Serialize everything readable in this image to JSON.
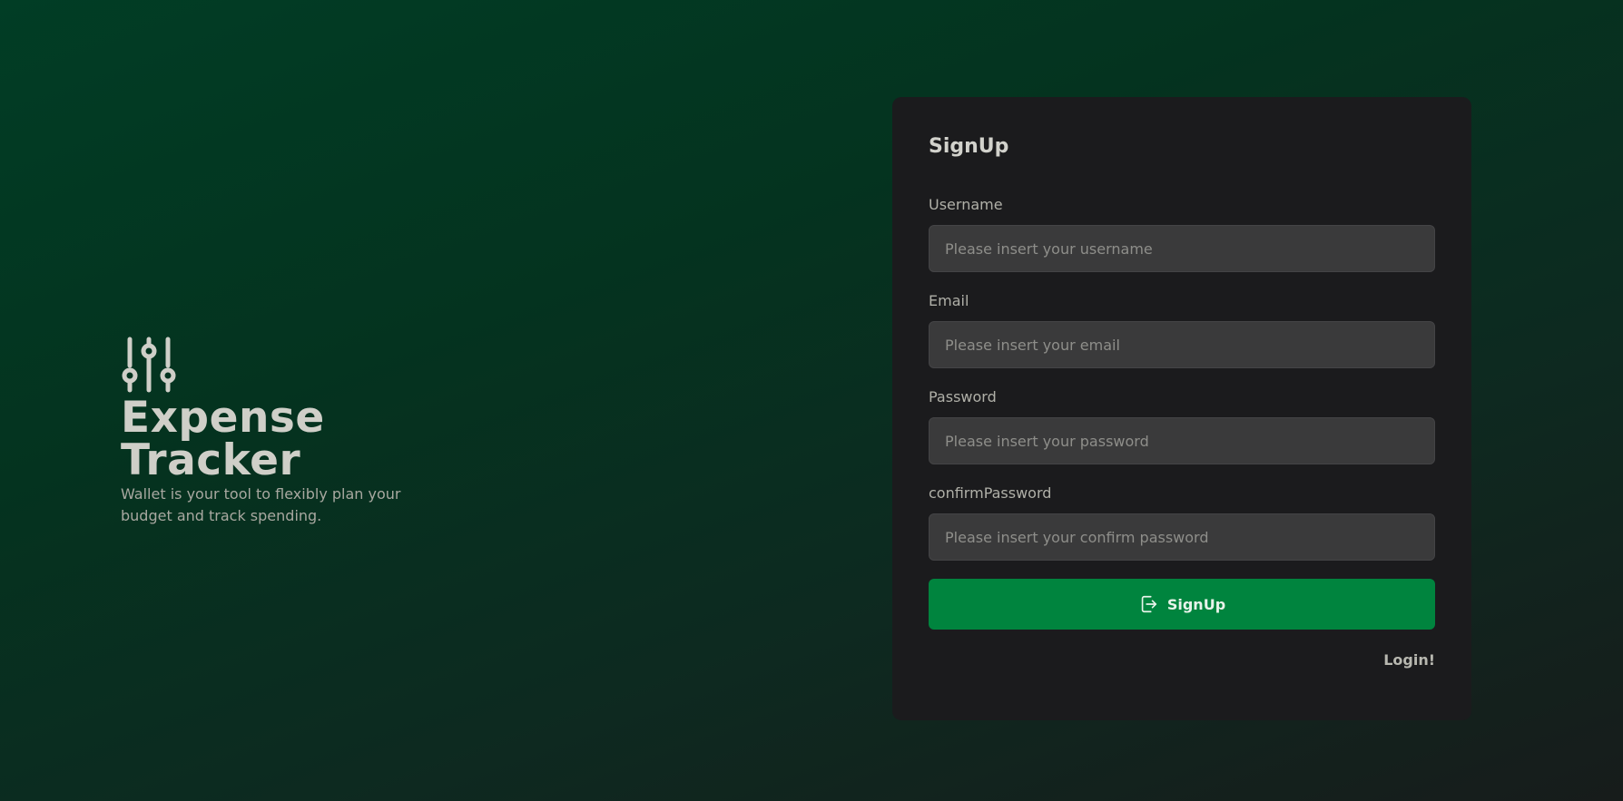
{
  "brand": {
    "icon": "sliders-icon",
    "title": "Expense Tracker",
    "subtitle": "Wallet is your tool to flexibly plan your budget and track spending."
  },
  "signup": {
    "heading": "SignUp",
    "fields": [
      {
        "label": "Username",
        "placeholder": "Please insert your username",
        "value": ""
      },
      {
        "label": "Email",
        "placeholder": "Please insert your email",
        "value": ""
      },
      {
        "label": "Password",
        "placeholder": "Please insert your password",
        "value": ""
      },
      {
        "label": "confirmPassword",
        "placeholder": "Please insert your confirm password",
        "value": ""
      }
    ],
    "submit_label": "SignUp",
    "submit_icon": "login-icon",
    "login_link": "Login!"
  },
  "colors": {
    "accent": "#00843e",
    "card_bg": "#1b1b1d",
    "input_bg": "#3a3a3b",
    "background_start": "#013d25",
    "background_end": "#171c1b"
  }
}
